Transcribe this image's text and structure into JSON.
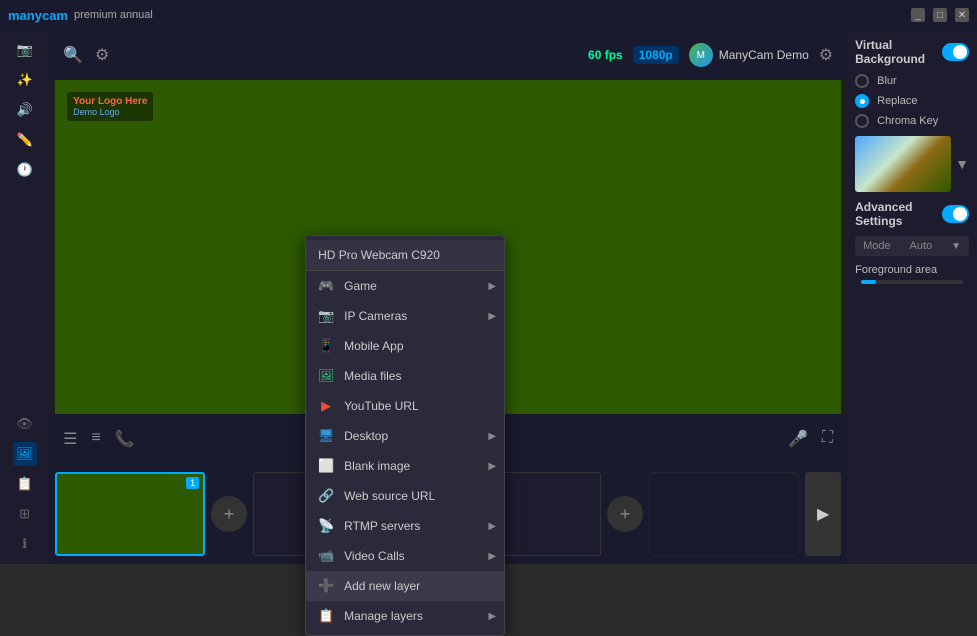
{
  "titlebar": {
    "logo": "manycam",
    "plan": "premium annual",
    "buttons": [
      "minimize",
      "maximize",
      "close"
    ]
  },
  "topbar": {
    "fps": "60 fps",
    "resolution": "1080p",
    "user_name": "ManyCam Demo",
    "zoom_icon": "🔍",
    "settings_icon": "⚙"
  },
  "context_menu": {
    "header": "HD Pro Webcam C920",
    "items": [
      {
        "id": "game",
        "label": "Game",
        "has_arrow": true,
        "icon": "game"
      },
      {
        "id": "ip-cameras",
        "label": "IP Cameras",
        "has_arrow": true,
        "icon": "ip"
      },
      {
        "id": "mobile-app",
        "label": "Mobile App",
        "has_arrow": false,
        "icon": "mobile"
      },
      {
        "id": "media-files",
        "label": "Media files",
        "has_arrow": false,
        "icon": "media"
      },
      {
        "id": "youtube-url",
        "label": "YouTube URL",
        "has_arrow": false,
        "icon": "youtube"
      },
      {
        "id": "desktop",
        "label": "Desktop",
        "has_arrow": true,
        "icon": "desktop"
      },
      {
        "id": "blank-image",
        "label": "Blank image",
        "has_arrow": true,
        "icon": "blank"
      },
      {
        "id": "web-source-url",
        "label": "Web source URL",
        "has_arrow": false,
        "icon": "web"
      },
      {
        "id": "rtmp-servers",
        "label": "RTMP servers",
        "has_arrow": true,
        "icon": "rtmp"
      },
      {
        "id": "video-calls",
        "label": "Video Calls",
        "has_arrow": true,
        "icon": "video"
      },
      {
        "id": "add-new-layer",
        "label": "Add new layer",
        "has_arrow": false,
        "icon": "add",
        "highlighted": true
      },
      {
        "id": "manage-layers",
        "label": "Manage layers",
        "has_arrow": true,
        "icon": "manage"
      }
    ]
  },
  "right_panel": {
    "title": "Virtual Background",
    "toggle_on": true,
    "radio_options": [
      {
        "id": "blur",
        "label": "Blur",
        "selected": false
      },
      {
        "id": "replace",
        "label": "Replace",
        "selected": true
      },
      {
        "id": "chroma-key",
        "label": "Chroma Key",
        "selected": false
      }
    ],
    "advanced_settings": "Advanced Settings",
    "advanced_toggle": true,
    "mode_label": "Mode",
    "mode_value": "Auto",
    "foreground_area": "Foreground area"
  },
  "bottom_bar": {
    "icons": [
      "menu",
      "list",
      "phone"
    ]
  },
  "demo_logo": {
    "top_text": "Your Logo Here",
    "bottom_text": "Demo Logo"
  }
}
